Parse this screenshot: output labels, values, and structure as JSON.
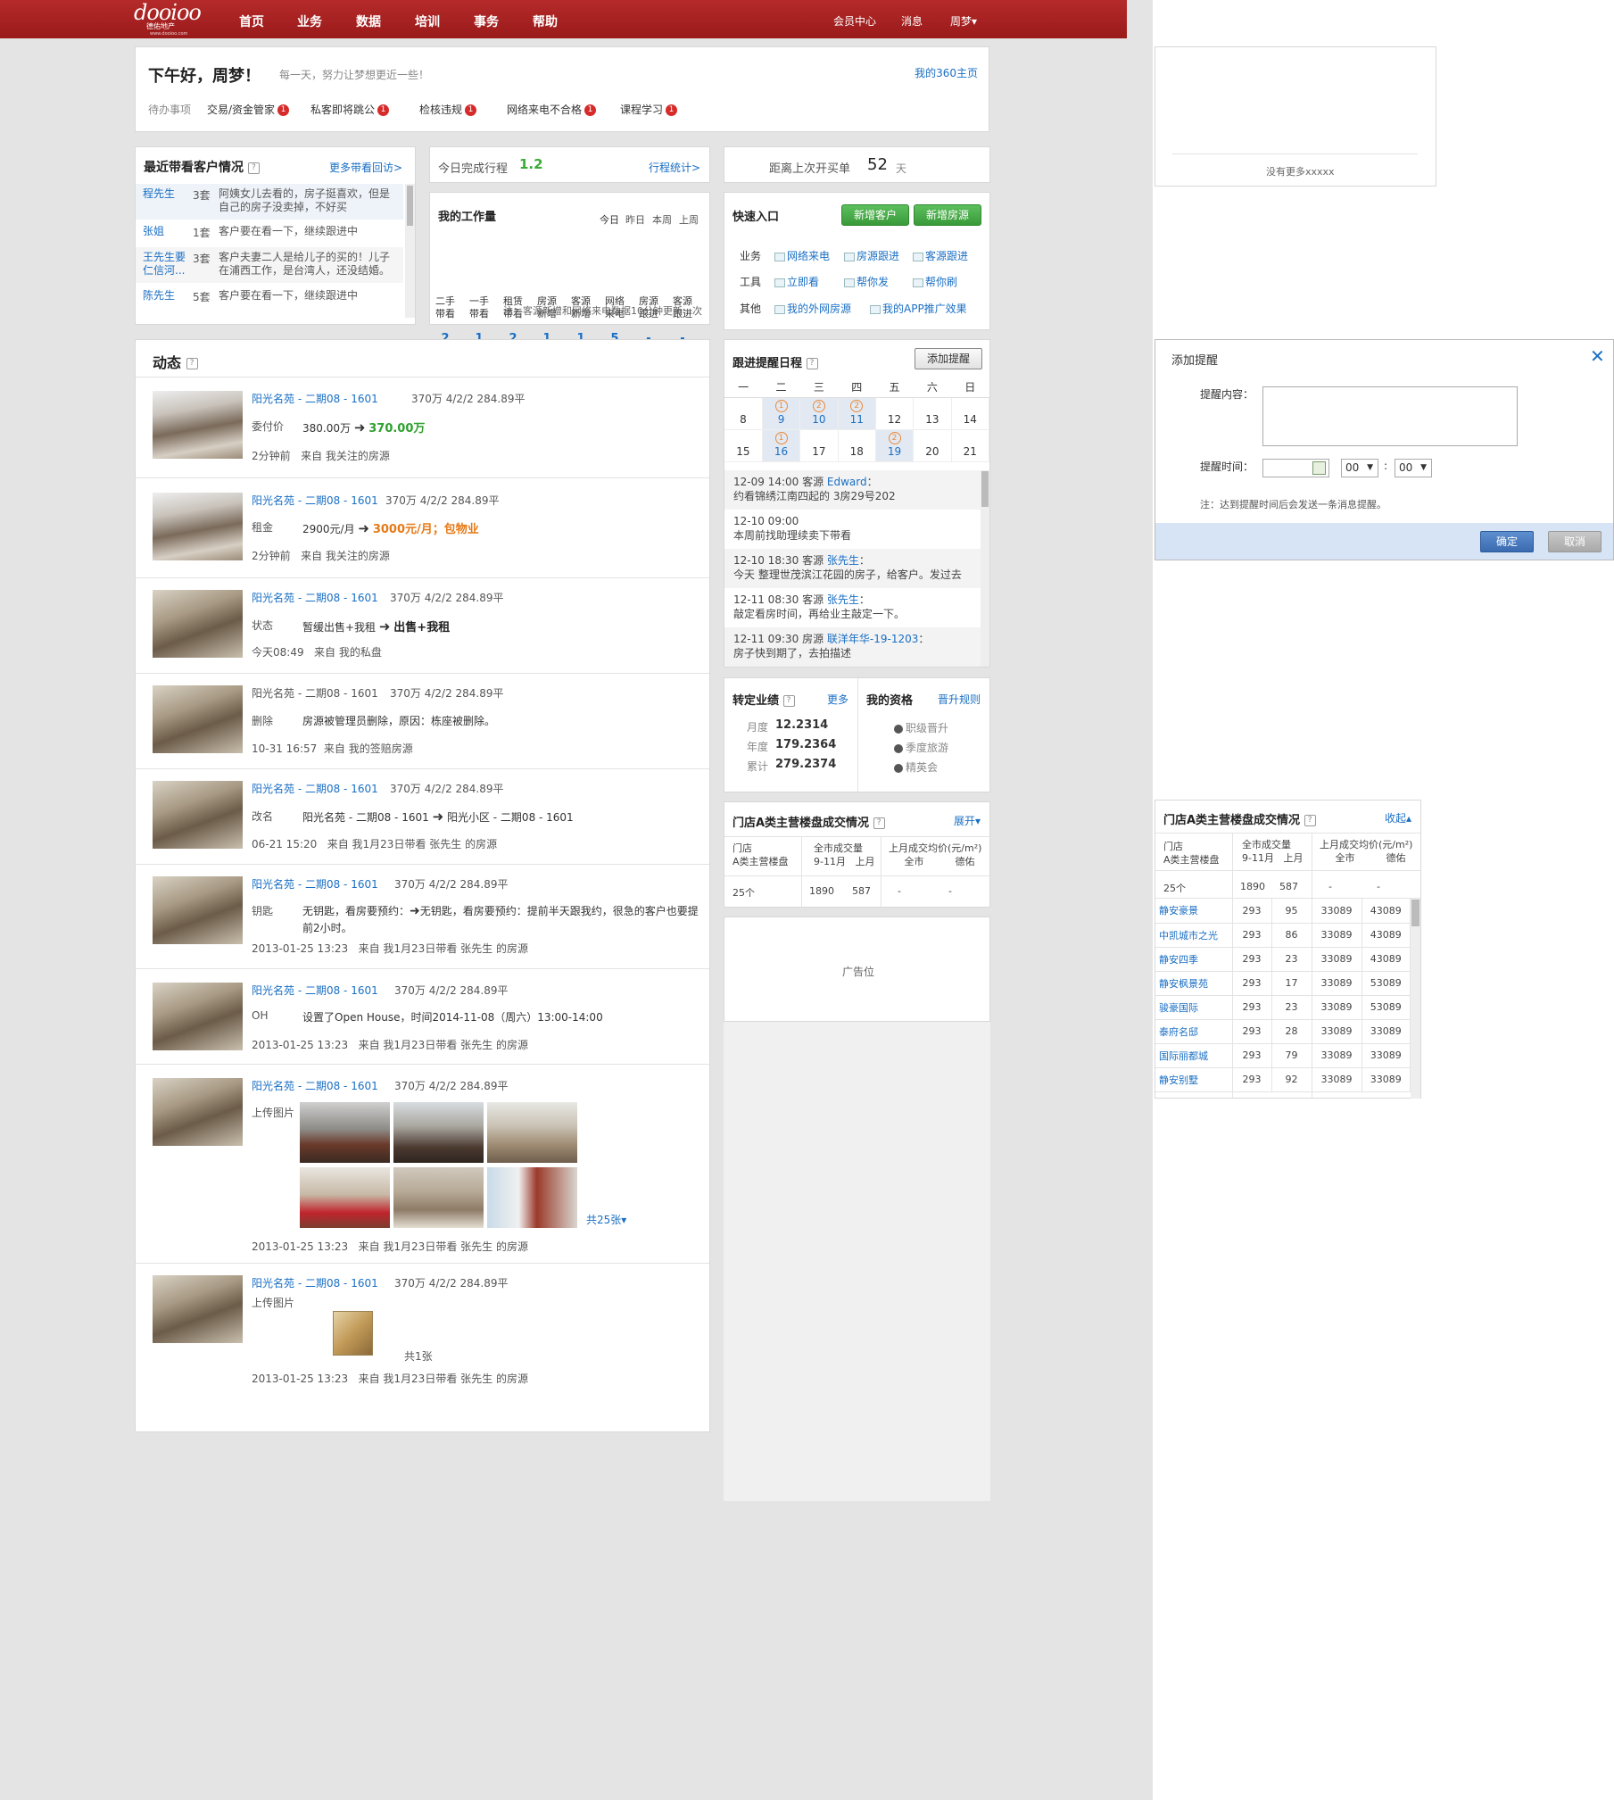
{
  "nav": {
    "logo_text": "dooioo",
    "logo_sub": "德佑地产",
    "logo_url": "www.dooioo.com",
    "items": [
      "首页",
      "业务",
      "数据",
      "培训",
      "事务",
      "帮助"
    ],
    "member": "会员中心",
    "messages": "消息",
    "user": "周梦▾"
  },
  "greeting": {
    "title": "下午好，周梦！",
    "motto": "每一天，努力让梦想更近一些！",
    "link": "我的360主页"
  },
  "todo": {
    "label": "待办事项",
    "items": [
      {
        "label": "交易/资金管家",
        "badge": "1"
      },
      {
        "label": "私客即将跳公",
        "badge": "1"
      },
      {
        "label": "检核违规",
        "badge": "1"
      },
      {
        "label": "网络来电不合格",
        "badge": "1"
      },
      {
        "label": "课程学习",
        "badge": "1"
      }
    ]
  },
  "recent": {
    "title": "最近带看客户情况",
    "more": "更多带看回访>",
    "rows": [
      {
        "name": "程先生",
        "count": "3套",
        "desc": "阿姨女儿去看的，房子挺喜欢，但是自己的房子没卖掉，不好买"
      },
      {
        "name": "张姐",
        "count": "1套",
        "desc": "客户要在看一下，继续跟进中"
      },
      {
        "name": "王先生要仁信河...",
        "count": "3套",
        "desc": "客户夫妻二人是给儿子的买的！儿子在浦西工作，是台湾人，还没结婚。"
      },
      {
        "name": "陈先生",
        "count": "5套",
        "desc": "客户要在看一下，继续跟进中"
      }
    ]
  },
  "today": {
    "label": "今日完成行程",
    "value": "1.2",
    "link": "行程统计>"
  },
  "workload": {
    "title": "我的工作量",
    "tabs": [
      "今日",
      "昨日",
      "本周",
      "上周"
    ],
    "cols": [
      {
        "l1": "二手",
        "l2": "带看",
        "v": "2"
      },
      {
        "l1": "一手",
        "l2": "带看",
        "v": "1"
      },
      {
        "l1": "租赁",
        "l2": "带看",
        "v": "2"
      },
      {
        "l1": "房源",
        "l2": "新增",
        "v": "1"
      },
      {
        "l1": "客源",
        "l2": "新增",
        "v": "1"
      },
      {
        "l1": "网络",
        "l2": "来电",
        "v": "5"
      },
      {
        "l1": "房源",
        "l2": "跟进",
        "v": "-"
      },
      {
        "l1": "客源",
        "l2": "跟进",
        "v": "-"
      }
    ],
    "note": "注：客源新增和网络来电数据10分钟更新一次"
  },
  "lastorder": {
    "label": "距离上次开买单",
    "value": "52",
    "unit": "天"
  },
  "quick": {
    "title": "快速入口",
    "btn1": "新增客户",
    "btn2": "新增房源",
    "rows": [
      {
        "label": "业务",
        "links": [
          "网络来电",
          "房源跟进",
          "客源跟进"
        ]
      },
      {
        "label": "工具",
        "links": [
          "立即看",
          "帮你发",
          "帮你刷"
        ]
      },
      {
        "label": "其他",
        "links": [
          "我的外网房源",
          "我的APP推广效果"
        ]
      }
    ]
  },
  "feed": {
    "title": "动态",
    "items": [
      {
        "title": "阳光名苑 - 二期08 - 1601",
        "meta": "370万  4/2/2  284.89平",
        "key": "委付价",
        "old": "380.00万",
        "new": "370.00万",
        "time": "2分钟前",
        "from": "来自 我关注的房源"
      },
      {
        "title": "阳光名苑 - 二期08 - 1601",
        "meta": "370万  4/2/2  284.89平",
        "key": "租金",
        "old": "2900元/月",
        "new": "3000元/月；包物业",
        "time": "2分钟前",
        "from": "来自 我关注的房源"
      },
      {
        "title": "阳光名苑 - 二期08 - 1601",
        "meta": "370万  4/2/2  284.89平",
        "key": "状态",
        "old": "暂缓出售+我租",
        "new": "出售+我租",
        "time": "今天08:49",
        "from": "来自 我的私盘"
      },
      {
        "title": "阳光名苑 - 二期08 - 1601",
        "meta": "370万  4/2/2  284.89平",
        "key": "删除",
        "text": "房源被管理员删除，原因：栋座被删除。",
        "time": "10-31 16:57",
        "from": "来自 我的签赔房源"
      },
      {
        "title": "阳光名苑 - 二期08 - 1601",
        "meta": "370万  4/2/2  284.89平",
        "key": "改名",
        "old": "阳光名苑 - 二期08 - 1601",
        "new": "阳光小区 - 二期08 - 1601",
        "time": "06-21 15:20",
        "from": "来自 我1月23日带看 张先生 的房源"
      },
      {
        "title": "阳光名苑 - 二期08 - 1601",
        "meta": "370万  4/2/2  284.89平",
        "key": "钥匙",
        "old": "无钥匙，看房要预约：",
        "new": "无钥匙，看房要预约：提前半天跟我约，很急的客户也要提前2小时。",
        "time": "2013-01-25 13:23",
        "from": "来自 我1月23日带看 张先生 的房源"
      },
      {
        "title": "阳光名苑 - 二期08 - 1601",
        "meta": "370万  4/2/2  284.89平",
        "key": "OH",
        "text": "设置了Open House，时间2014-11-08（周六）13:00-14:00",
        "time": "2013-01-25 13:23",
        "from": "来自 我1月23日带看 张先生 的房源"
      },
      {
        "title": "阳光名苑 - 二期08 - 1601",
        "meta": "370万  4/2/2  284.89平",
        "key": "上传图片",
        "more": "共25张▾",
        "time": "2013-01-25 13:23",
        "from": "来自 我1月23日带看 张先生 的房源"
      },
      {
        "title": "阳光名苑 - 二期08 - 1601",
        "meta": "370万  4/2/2  284.89平",
        "key": "上传图片",
        "more": "共1张",
        "time": "2013-01-25 13:23",
        "from": "来自 我1月23日带看 张先生 的房源"
      }
    ]
  },
  "schedule": {
    "title": "跟进提醒日程",
    "add": "添加提醒",
    "weekdays": [
      "一",
      "二",
      "三",
      "四",
      "五",
      "六",
      "日"
    ],
    "week1": [
      "8",
      "9",
      "10",
      "11",
      "12",
      "13",
      "14"
    ],
    "week2": [
      "15",
      "16",
      "17",
      "18",
      "19",
      "20",
      "21"
    ],
    "marks": {
      "9": "1",
      "10": "2",
      "11": "2",
      "16": "1",
      "19": "2"
    },
    "events": [
      {
        "head": "12-09  14:00 客源 ",
        "who": "Edward",
        "tail": "：",
        "body": "约看锦绣江南四起的 3房29号202"
      },
      {
        "head": "12-10  09:00",
        "who": "",
        "tail": "",
        "body": "本周前找助理续卖下带看"
      },
      {
        "head": "12-10  18:30 客源 ",
        "who": "张先生",
        "tail": "：",
        "body": "今天 整理世茂滨江花园的房子，给客户。发过去"
      },
      {
        "head": "12-11  08:30 客源 ",
        "who": "张先生",
        "tail": "：",
        "body": "敲定看房时间，再给业主敲定一下。"
      },
      {
        "head": "12-11  09:30 房源 ",
        "who": "联洋年华-19-1203",
        "tail": "：",
        "body": "房子快到期了，去拍描述"
      }
    ]
  },
  "perf": {
    "title": "转定业绩",
    "more": "更多",
    "rows": [
      {
        "k": "月度",
        "v": "12.2314"
      },
      {
        "k": "年度",
        "v": "179.2364"
      },
      {
        "k": "累计",
        "v": "279.2374"
      }
    ]
  },
  "qual": {
    "title": "我的资格",
    "rule": "晋升规则",
    "items": [
      "职级晋升",
      "季度旅游",
      "精英会"
    ]
  },
  "deals": {
    "title": "门店A类主营楼盘成交情况",
    "toggle": "展开▾",
    "h1": "门店",
    "h1b": "A类主营楼盘",
    "h2": "全市成交量",
    "h2a": "9-11月",
    "h2b": "上月",
    "h3": "上月成交均价(元/m²)",
    "h3a": "全市",
    "h3b": "德佑",
    "total": [
      "25个",
      "1890",
      "587",
      "-",
      "-"
    ]
  },
  "ad": "广告位",
  "side_empty": "没有更多xxxxx",
  "dialog": {
    "title": "添加提醒",
    "content_label": "提醒内容：",
    "time_label": "提醒时间：",
    "h": "00",
    "m": "00",
    "note": "注：达到提醒时间后会发送一条消息提醒。",
    "ok": "确定",
    "cancel": "取消"
  },
  "deals2": {
    "title": "门店A类主营楼盘成交情况",
    "toggle": "收起▴",
    "rows": [
      [
        "静安豪景",
        "293",
        "95",
        "33089",
        "43089"
      ],
      [
        "中凯城市之光",
        "293",
        "86",
        "33089",
        "43089"
      ],
      [
        "静安四季",
        "293",
        "23",
        "33089",
        "43089"
      ],
      [
        "静安枫景苑",
        "293",
        "17",
        "33089",
        "53089"
      ],
      [
        "骏豪国际",
        "293",
        "23",
        "33089",
        "53089"
      ],
      [
        "泰府名邸",
        "293",
        "28",
        "33089",
        "33089"
      ],
      [
        "国际丽都城",
        "293",
        "79",
        "33089",
        "33089"
      ],
      [
        "静安别墅",
        "293",
        "92",
        "33089",
        "33089"
      ]
    ]
  }
}
